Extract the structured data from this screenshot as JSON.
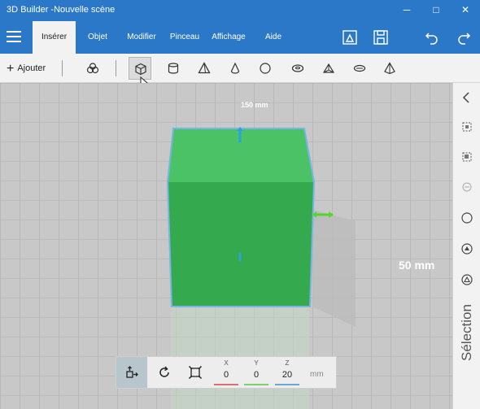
{
  "window": {
    "title": "3D Builder -Nouvelle scène",
    "controls": {
      "minimize": "─",
      "maximize": "□",
      "close": "✕"
    }
  },
  "ribbon": {
    "menu_icon": "hamburger-icon",
    "tabs": [
      {
        "label": "Insérer",
        "active": true
      },
      {
        "label": "Objet",
        "active": false
      },
      {
        "label": "Modifier",
        "active": false
      },
      {
        "label": "Pinceau",
        "active": false
      },
      {
        "label": "Affichage",
        "active": false
      },
      {
        "label": "Aide",
        "active": false
      }
    ],
    "right_icons": [
      "print-3d-icon",
      "save-icon",
      "undo-icon",
      "redo-icon"
    ]
  },
  "toolbar": {
    "add_label": "Ajouter",
    "shapes": [
      "group-icon",
      "cube-icon",
      "cylinder-icon",
      "pyramid-icon",
      "cone-icon",
      "sphere-icon",
      "torus-icon",
      "wedge-icon",
      "ellipsoid-icon",
      "tetrahedron-icon"
    ],
    "selected_shape": "cube-icon"
  },
  "viewport": {
    "labels": {
      "dimension_top": "150 mm",
      "dimension_side": "50 mm"
    },
    "object_color": "#3fb055",
    "selection_outline_color": "#78b4e6",
    "handle_vertical_color": "#29a3e0",
    "handle_horizontal_color": "#55d62a"
  },
  "sidebar": {
    "collapse_icon": "chevron-left-icon",
    "icons": [
      "select-object-icon",
      "select-face-icon",
      "select-edge-icon",
      "select-vertex-icon",
      "select-fill-icon",
      "select-mesh-icon"
    ],
    "label": "Sélection"
  },
  "bottombar": {
    "tools": [
      {
        "name": "move-icon",
        "active": true
      },
      {
        "name": "rotate-icon",
        "active": false
      },
      {
        "name": "scale-icon",
        "active": false
      }
    ],
    "coords": [
      {
        "label": "X",
        "value": "0",
        "color": "#d87070"
      },
      {
        "label": "Y",
        "value": "0",
        "color": "#7ecf6a"
      },
      {
        "label": "Z",
        "value": "20",
        "color": "#6aa8d8"
      }
    ],
    "unit": "mm"
  },
  "colors": {
    "accent": "#2b78c8",
    "toolbar_bg": "#f2f2f2",
    "floor": "#c8c8c8"
  }
}
